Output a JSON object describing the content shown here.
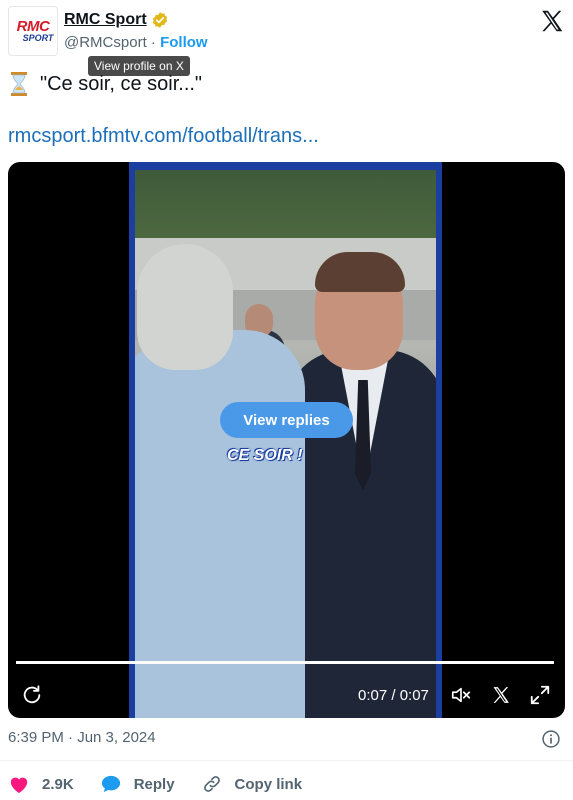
{
  "account": {
    "name": "RMC Sport",
    "handle": "@RMCsport",
    "separator": "·",
    "follow_label": "Follow",
    "avatar_text_top": "RMC",
    "avatar_text_bottom": "SPORT",
    "verified_icon": "verified-badge-icon"
  },
  "tooltip": "View profile on X",
  "tweet": {
    "text": "\"Ce soir, ce soir...\"",
    "emoji_icon": "hourglass-icon",
    "link": "rmcsport.bfmtv.com/football/trans..."
  },
  "media": {
    "caption": "CE SOIR !",
    "view_replies_label": "View replies",
    "time": "0:07 / 0:07",
    "progress": 1.0
  },
  "footer": {
    "timestamp": "6:39 PM · Jun 3, 2024",
    "likes": "2.9K",
    "reply_label": "Reply",
    "copy_link_label": "Copy link"
  },
  "colors": {
    "accent": "#1d9bf0",
    "link": "#1d6fb8",
    "like": "#f91880",
    "reply": "#1d9bf0"
  }
}
